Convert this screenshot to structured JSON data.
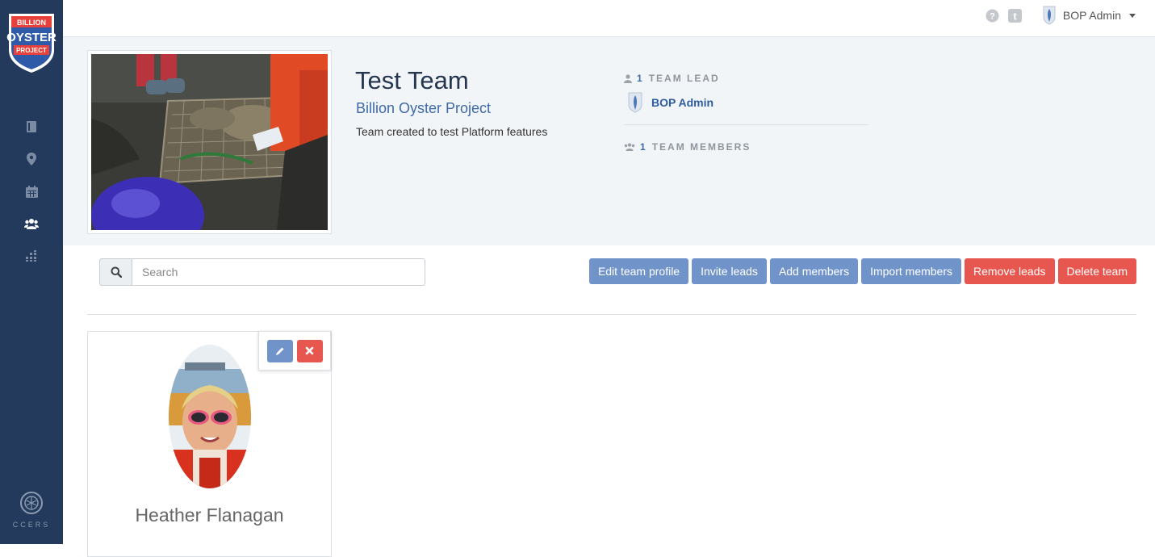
{
  "sidebar": {
    "logo": {
      "line1": "BILLION",
      "line2": "OYSTER",
      "line3": "PROJECT"
    },
    "nav": [
      {
        "icon": "book-icon"
      },
      {
        "icon": "map-marker-icon"
      },
      {
        "icon": "calendar-icon"
      },
      {
        "icon": "users-icon",
        "active": true
      },
      {
        "icon": "grid-icon"
      }
    ],
    "footer_label": "CCERS"
  },
  "topbar": {
    "help_icon": "question-circle-icon",
    "tumblr_icon": "tumblr-icon",
    "user_name": "BOP Admin"
  },
  "team": {
    "title": "Test Team",
    "org": "Billion Oyster Project",
    "description": "Team created to test Platform features",
    "lead_count": "1",
    "lead_label": "TEAM LEAD",
    "lead_name": "BOP Admin",
    "member_count": "1",
    "member_label": "TEAM MEMBERS"
  },
  "toolbar": {
    "search_placeholder": "Search",
    "buttons": {
      "edit": "Edit team profile",
      "invite": "Invite leads",
      "add": "Add members",
      "import": "Import members",
      "remove": "Remove leads",
      "delete": "Delete team"
    }
  },
  "members": [
    {
      "name": "Heather Flanagan"
    }
  ],
  "colors": {
    "sidebar": "#233a5c",
    "primary_button": "#7094c9",
    "danger_button": "#e8574f",
    "link": "#3e6aa6"
  }
}
